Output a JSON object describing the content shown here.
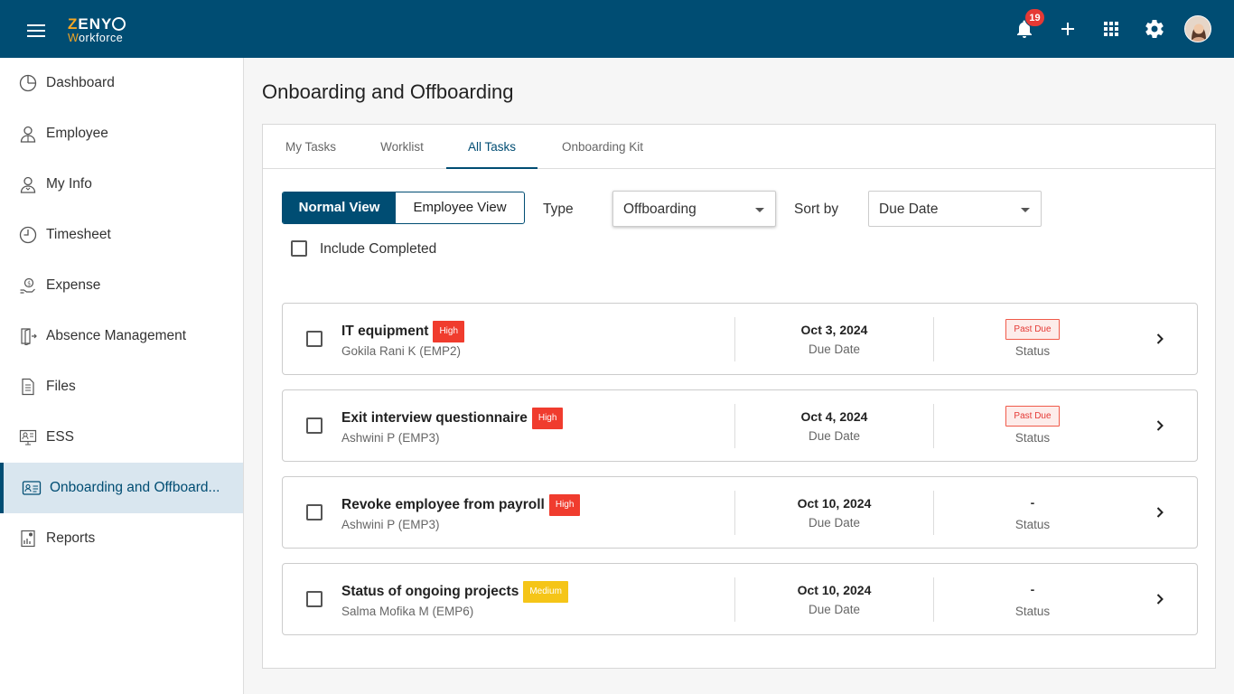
{
  "app": {
    "logo_line1_z": "Z",
    "logo_line1_rest": "ENY",
    "logo_line2_w": "W",
    "logo_line2_rest": "orkforce",
    "notification_count": "19"
  },
  "sidebar": {
    "items": [
      {
        "label": "Dashboard",
        "icon": "dashboard-icon"
      },
      {
        "label": "Employee",
        "icon": "employee-icon"
      },
      {
        "label": "My Info",
        "icon": "my-info-icon"
      },
      {
        "label": "Timesheet",
        "icon": "clock-icon"
      },
      {
        "label": "Expense",
        "icon": "expense-icon"
      },
      {
        "label": "Absence Management",
        "icon": "absence-icon"
      },
      {
        "label": "Files",
        "icon": "file-icon"
      },
      {
        "label": "ESS",
        "icon": "ess-icon"
      },
      {
        "label": "Onboarding and Offboard...",
        "icon": "id-card-icon",
        "active": true
      },
      {
        "label": "Reports",
        "icon": "report-icon"
      }
    ]
  },
  "page": {
    "title": "Onboarding and Offboarding"
  },
  "tabs": [
    "My Tasks",
    "Worklist",
    "All Tasks",
    "Onboarding Kit"
  ],
  "active_tab": "All Tasks",
  "filters": {
    "view_normal": "Normal View",
    "view_employee": "Employee View",
    "type_label": "Type",
    "type_value": "Offboarding",
    "sort_label": "Sort by",
    "sort_value": "Due Date",
    "include_completed": "Include Completed"
  },
  "tasks": [
    {
      "title": "IT equipment",
      "priority": "High",
      "employee": "Gokila Rani K (EMP2)",
      "date": "Oct 3, 2024",
      "date_label": "Due Date",
      "status": "Past Due",
      "status_label": "Status"
    },
    {
      "title": "Exit interview questionnaire",
      "priority": "High",
      "employee": "Ashwini P (EMP3)",
      "date": "Oct 4, 2024",
      "date_label": "Due Date",
      "status": "Past Due",
      "status_label": "Status"
    },
    {
      "title": "Revoke employee from payroll",
      "priority": "High",
      "employee": "Ashwini P (EMP3)",
      "date": "Oct 10, 2024",
      "date_label": "Due Date",
      "status": "-",
      "status_label": "Status"
    },
    {
      "title": "Status of ongoing projects",
      "priority": "Medium",
      "employee": "Salma Mofika M (EMP6)",
      "date": "Oct 10, 2024",
      "date_label": "Due Date",
      "status": "-",
      "status_label": "Status"
    }
  ],
  "colors": {
    "brand": "#004d73",
    "accent": "#f5a623",
    "priority_high": "#f03c2e",
    "priority_medium": "#f5c518",
    "past_due": "#e53935"
  }
}
